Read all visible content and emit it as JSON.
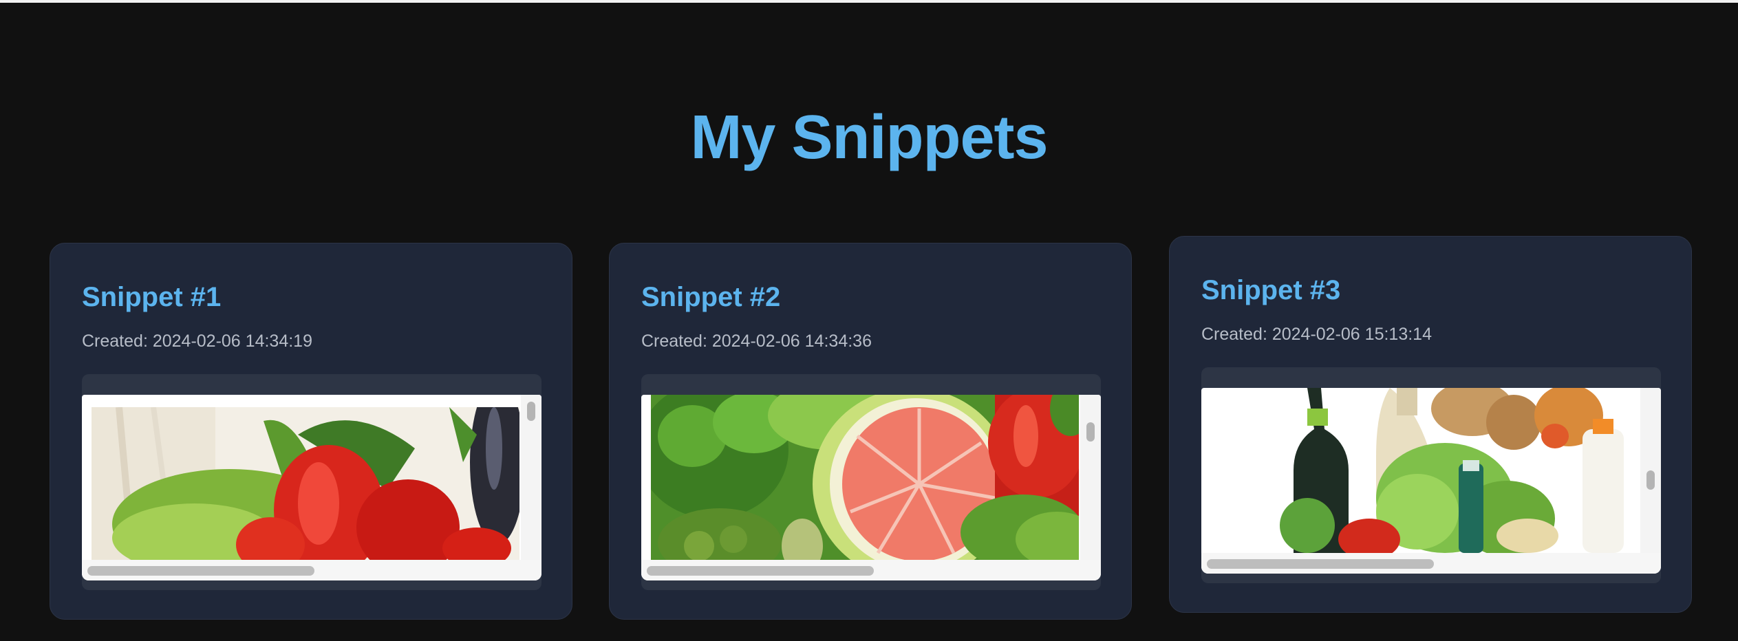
{
  "page": {
    "title": "My Snippets"
  },
  "snippets": [
    {
      "title": "Snippet #1",
      "created": "Created: 2024-02-06 14:34:19",
      "image": "vegetables-peppers-image"
    },
    {
      "title": "Snippet #2",
      "created": "Created: 2024-02-06 14:34:36",
      "image": "grapefruit-greens-image"
    },
    {
      "title": "Snippet #3",
      "created": "Created: 2024-02-06 15:13:14",
      "image": "groceries-bottles-image"
    }
  ],
  "colors": {
    "background": "#111111",
    "card": "#1f2739",
    "accent": "#5cb4ee",
    "muted_text": "#b7bdc8"
  }
}
